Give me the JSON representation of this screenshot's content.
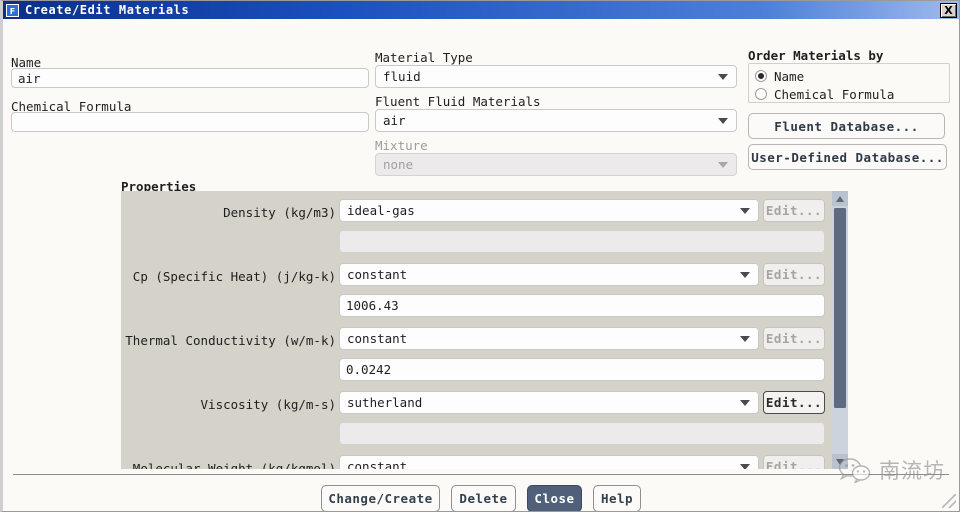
{
  "window": {
    "title": "Create/Edit Materials",
    "app_icon": "F",
    "close_label": "X"
  },
  "left": {
    "name_label": "Name",
    "name_value": "air",
    "formula_label": "Chemical Formula",
    "formula_value": ""
  },
  "middle": {
    "material_type_label": "Material Type",
    "material_type_value": "fluid",
    "fluent_materials_label": "Fluent Fluid Materials",
    "fluent_materials_value": "air",
    "mixture_label": "Mixture",
    "mixture_value": "none"
  },
  "order_by": {
    "title": "Order Materials by",
    "options": [
      {
        "label": "Name",
        "selected": true
      },
      {
        "label": "Chemical Formula",
        "selected": false
      }
    ],
    "fluent_database_button": "Fluent Database...",
    "user_defined_database_button": "User-Defined Database..."
  },
  "properties": {
    "title": "Properties",
    "edit_label": "Edit...",
    "rows": [
      {
        "label": "Density (kg/m3)",
        "method": "ideal-gas",
        "value": "",
        "value_disabled": true,
        "edit_enabled": false
      },
      {
        "label": "Cp (Specific Heat) (j/kg-k)",
        "method": "constant",
        "value": "1006.43",
        "value_disabled": false,
        "edit_enabled": false
      },
      {
        "label": "Thermal Conductivity (w/m-k)",
        "method": "constant",
        "value": "0.0242",
        "value_disabled": false,
        "edit_enabled": false
      },
      {
        "label": "Viscosity (kg/m-s)",
        "method": "sutherland",
        "value": "",
        "value_disabled": true,
        "edit_enabled": true
      },
      {
        "label": "Molecular Weight (kg/kgmol)",
        "method": "constant",
        "value": "",
        "value_disabled": false,
        "edit_enabled": false
      }
    ]
  },
  "footer": {
    "buttons": [
      {
        "label": "Change/Create",
        "primary": false
      },
      {
        "label": "Delete",
        "primary": false
      },
      {
        "label": "Close",
        "primary": true
      },
      {
        "label": "Help",
        "primary": false
      }
    ]
  },
  "watermark": {
    "text": "南流坊",
    "icon": "wechat-icon"
  },
  "colors": {
    "titlebar_start": "#0b2f8a",
    "titlebar_end": "#9dbaec",
    "panel_bg": "#d5d2ca",
    "primary_button": "#50607a",
    "scrollbar_thumb": "#5d6a82"
  }
}
